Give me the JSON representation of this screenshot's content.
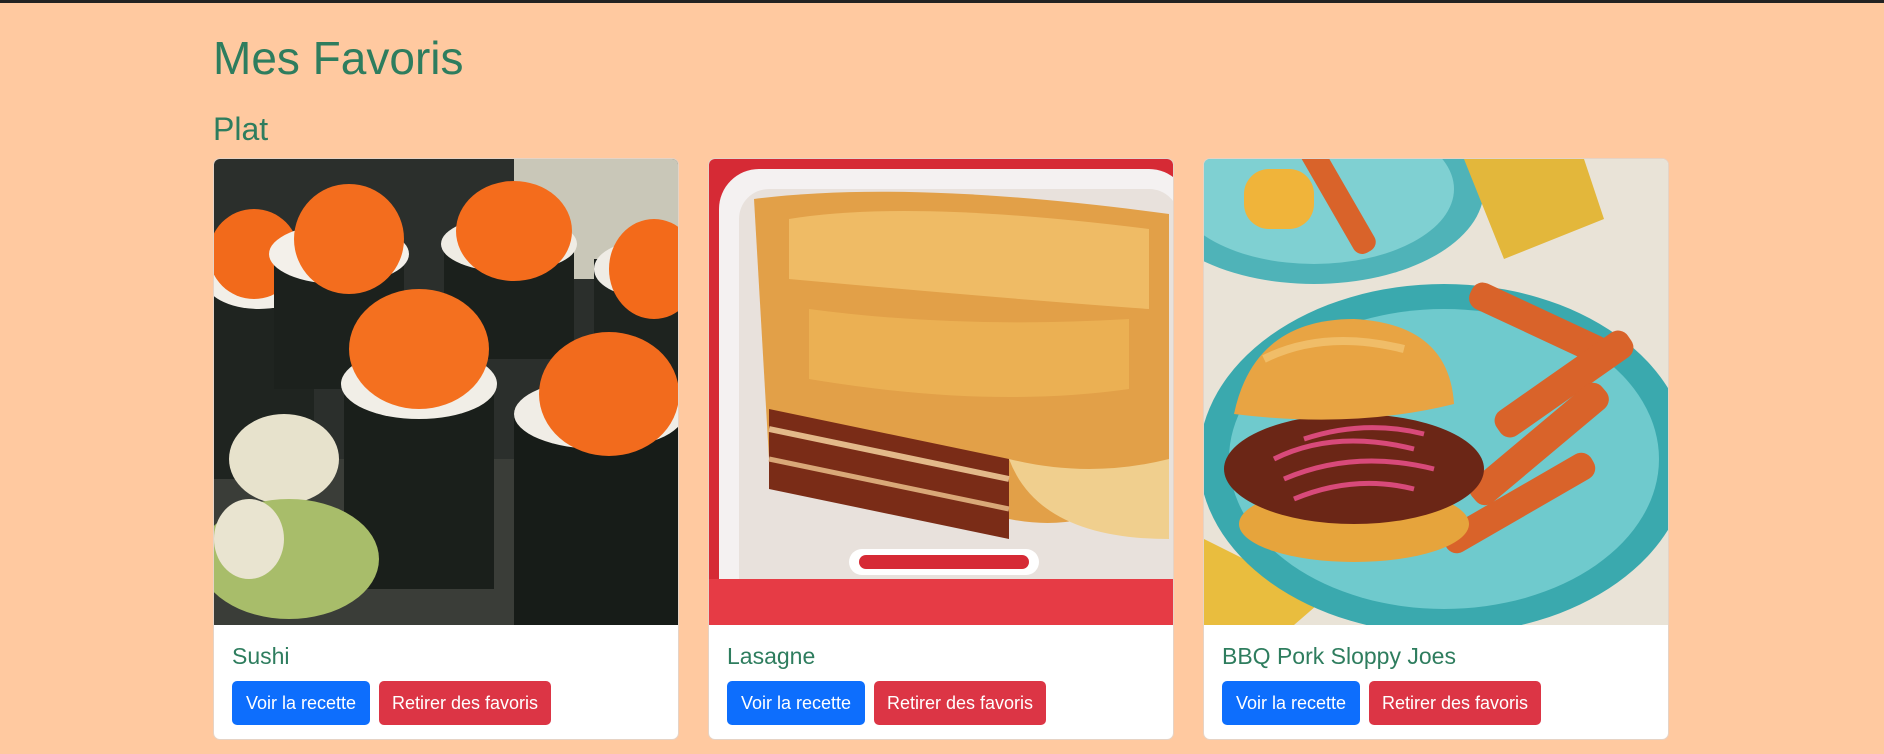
{
  "page": {
    "title": "Mes Favoris",
    "section_title": "Plat"
  },
  "cards": [
    {
      "title": "Sushi",
      "image": "sushi-photo",
      "view_label": "Voir la recette",
      "remove_label": "Retirer des favoris"
    },
    {
      "title": "Lasagne",
      "image": "lasagne-photo",
      "view_label": "Voir la recette",
      "remove_label": "Retirer des favoris"
    },
    {
      "title": "BBQ Pork Sloppy Joes",
      "image": "sloppy-joes-photo",
      "view_label": "Voir la recette",
      "remove_label": "Retirer des favoris"
    }
  ],
  "colors": {
    "background": "#ffc9a0",
    "heading": "#2e7d5e",
    "primary_button": "#0d6efd",
    "danger_button": "#dc3545"
  }
}
